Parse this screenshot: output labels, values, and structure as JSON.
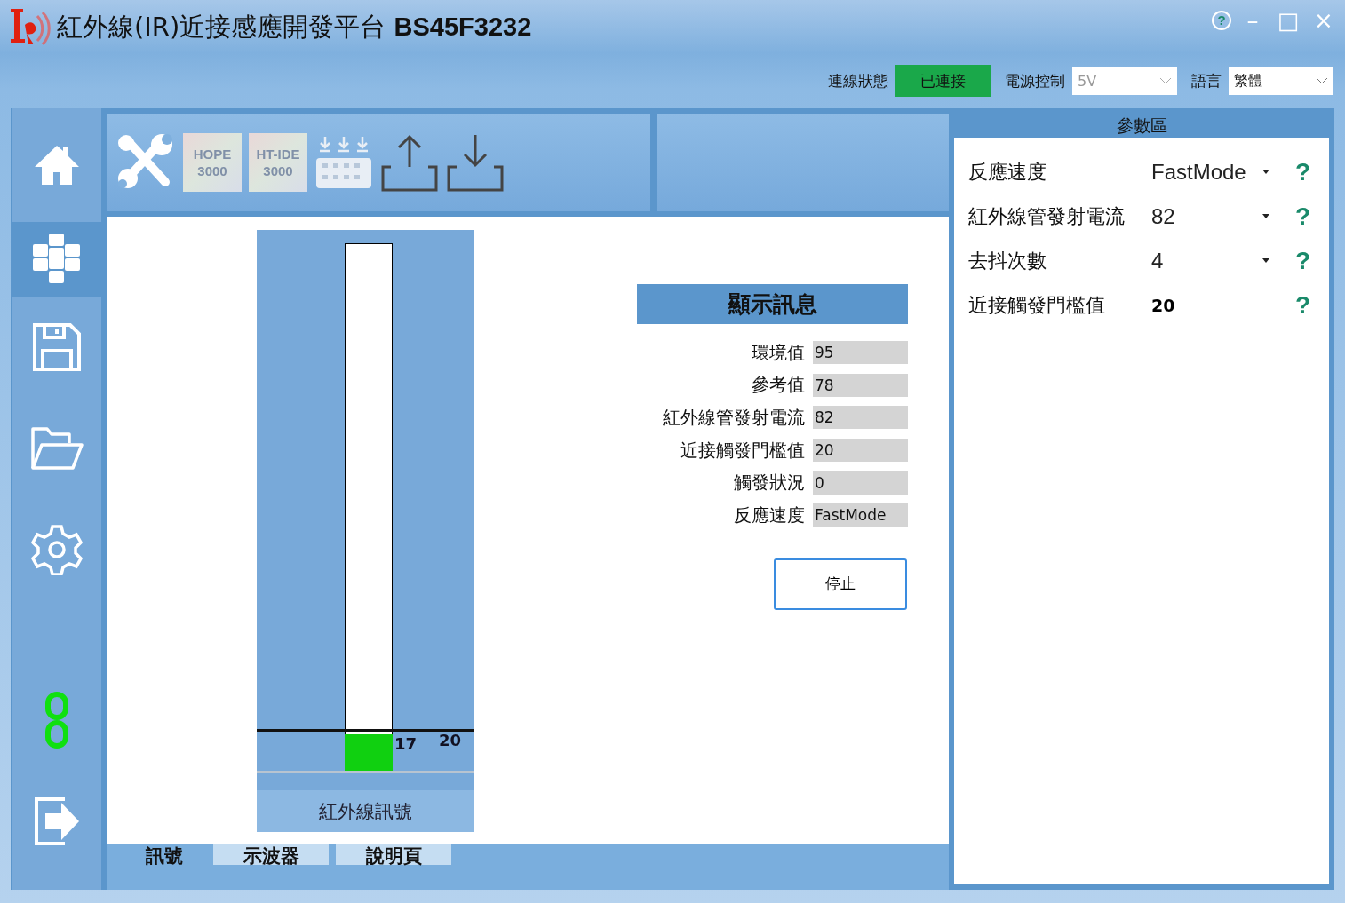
{
  "window": {
    "title_cn": "紅外線(IR)近接感應開發平台",
    "title_model": "BS45F3232",
    "controls": [
      "?",
      "–",
      "□",
      "×"
    ]
  },
  "status_bar": {
    "connection_label": "連線狀態",
    "connection_value": "已連接",
    "connected": true,
    "power_label": "電源控制",
    "power_value": "5V",
    "power_disabled": true,
    "language_label": "語言",
    "language_value": "繁體"
  },
  "sidebar": {
    "items": [
      {
        "kind": "home",
        "selected": false
      },
      {
        "kind": "modules",
        "selected": true
      },
      {
        "kind": "save",
        "selected": false
      },
      {
        "kind": "open",
        "selected": false
      },
      {
        "kind": "settings",
        "selected": false
      }
    ],
    "bottom_items": [
      {
        "kind": "link"
      },
      {
        "kind": "exit"
      }
    ]
  },
  "toolbar": {
    "items": [
      {
        "kind": "tools"
      },
      {
        "kind": "tile",
        "lines": [
          "HOPE",
          "3000"
        ]
      },
      {
        "kind": "tile",
        "lines": [
          "HT-IDE",
          "3000"
        ]
      },
      {
        "kind": "program"
      },
      {
        "kind": "upload"
      },
      {
        "kind": "download"
      }
    ]
  },
  "meter": {
    "level": 0.07,
    "value": "17",
    "threshold": "20",
    "label": "紅外線訊號"
  },
  "info": {
    "title": "顯示訊息",
    "rows": [
      {
        "label": "環境值",
        "value": "95"
      },
      {
        "label": "參考值",
        "value": "78"
      },
      {
        "label": "紅外線管發射電流",
        "value": "82"
      },
      {
        "label": "近接觸發門檻值",
        "value": "20"
      },
      {
        "label": "觸發狀況",
        "value": "0"
      },
      {
        "label": "反應速度",
        "value": "FastMode"
      }
    ],
    "button": "停止"
  },
  "tabs": [
    {
      "label": "訊號",
      "selected": true
    },
    {
      "label": "示波器",
      "selected": false
    },
    {
      "label": "說明頁",
      "selected": false
    }
  ],
  "params": {
    "title": "參數區",
    "rows": [
      {
        "kind": "dropdown",
        "label": "反應速度",
        "value": "FastMode",
        "help": "?"
      },
      {
        "kind": "dropdown",
        "label": "紅外線管發射電流",
        "value": "82",
        "help": "?"
      },
      {
        "kind": "dropdown",
        "label": "去抖次數",
        "value": "4",
        "help": "?"
      },
      {
        "kind": "text",
        "label": "近接觸發門檻值",
        "value": "20",
        "help": "?"
      }
    ]
  }
}
